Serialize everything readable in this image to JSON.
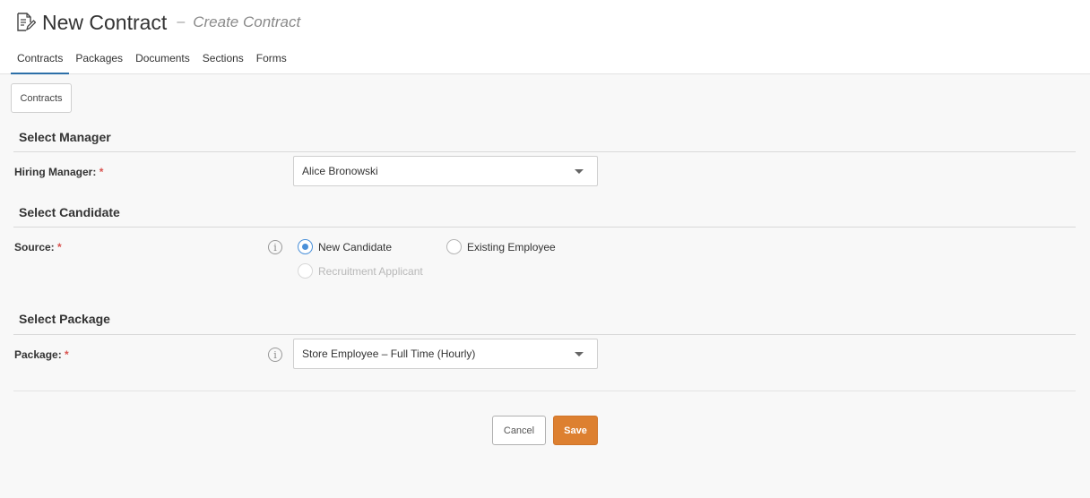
{
  "header": {
    "title": "New Contract",
    "separator": "–",
    "subtitle": "Create Contract",
    "icon": "edit-document-icon"
  },
  "tabs": [
    {
      "label": "Contracts",
      "active": true
    },
    {
      "label": "Packages",
      "active": false
    },
    {
      "label": "Documents",
      "active": false
    },
    {
      "label": "Sections",
      "active": false
    },
    {
      "label": "Forms",
      "active": false
    }
  ],
  "breadcrumb": {
    "label": "Contracts"
  },
  "sections": {
    "manager": {
      "title": "Select Manager",
      "label": "Hiring Manager:",
      "required": "*",
      "value": "Alice Bronowski"
    },
    "candidate": {
      "title": "Select Candidate",
      "label": "Source:",
      "required": "*",
      "info_icon": "i",
      "options": [
        {
          "label": "New Candidate",
          "checked": true,
          "disabled": false
        },
        {
          "label": "Existing Employee",
          "checked": false,
          "disabled": false
        },
        {
          "label": "Recruitment Applicant",
          "checked": false,
          "disabled": true
        }
      ]
    },
    "package": {
      "title": "Select Package",
      "label": "Package:",
      "required": "*",
      "info_icon": "i",
      "value": "Store Employee – Full Time (Hourly)"
    }
  },
  "actions": {
    "cancel_label": "Cancel",
    "save_label": "Save"
  },
  "colors": {
    "accent": "#2c6fa8",
    "save": "#dd8030",
    "radio": "#4a90d9",
    "required": "#d9534f"
  }
}
